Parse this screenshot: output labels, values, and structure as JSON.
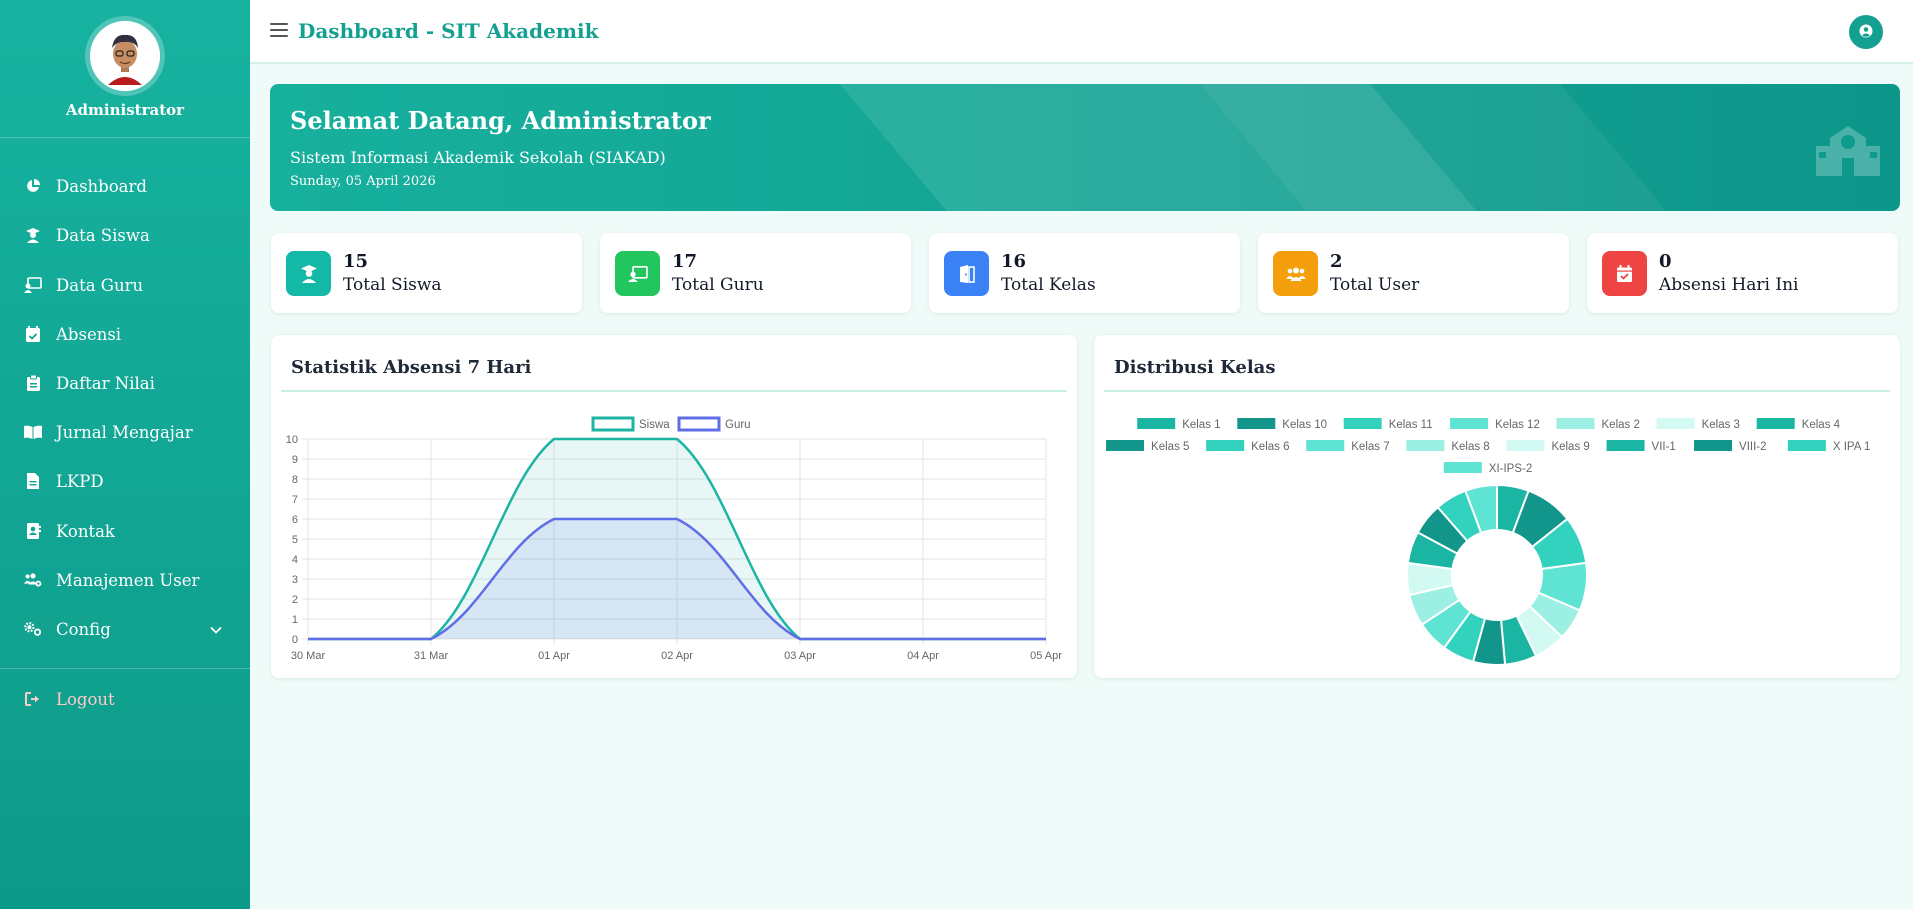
{
  "sidebar": {
    "user_name": "Administrator",
    "items": [
      {
        "label": "Dashboard",
        "icon": "chart-pie-icon"
      },
      {
        "label": "Data Siswa",
        "icon": "user-graduate-icon"
      },
      {
        "label": "Data Guru",
        "icon": "chalkboard-teacher-icon"
      },
      {
        "label": "Absensi",
        "icon": "calendar-check-icon"
      },
      {
        "label": "Daftar Nilai",
        "icon": "clipboard-icon"
      },
      {
        "label": "Jurnal Mengajar",
        "icon": "book-open-icon"
      },
      {
        "label": "LKPD",
        "icon": "file-icon"
      },
      {
        "label": "Kontak",
        "icon": "address-book-icon"
      },
      {
        "label": "Manajemen User",
        "icon": "users-cog-icon"
      },
      {
        "label": "Config",
        "icon": "gear-icon"
      }
    ],
    "logout": "Logout"
  },
  "topbar": {
    "title": "Dashboard - SIT Akademik"
  },
  "banner": {
    "title": "Selamat Datang, Administrator",
    "subtitle": "Sistem Informasi Akademik Sekolah (SIAKAD)",
    "date": "Sunday, 05 April 2026"
  },
  "stats": [
    {
      "value": "15",
      "label": "Total Siswa",
      "color": "#14b8a6",
      "icon": "user-graduate-icon"
    },
    {
      "value": "17",
      "label": "Total Guru",
      "color": "#22c55e",
      "icon": "chalkboard-teacher-icon"
    },
    {
      "value": "16",
      "label": "Total Kelas",
      "color": "#3b82f6",
      "icon": "door-open-icon"
    },
    {
      "value": "2",
      "label": "Total User",
      "color": "#f59e0b",
      "icon": "users-icon"
    },
    {
      "value": "0",
      "label": "Absensi Hari Ini",
      "color": "#ef4444",
      "icon": "calendar-check-icon"
    }
  ],
  "charts": {
    "line_title": "Statistik Absensi 7 Hari",
    "donut_title": "Distribusi Kelas"
  },
  "chart_data": [
    {
      "type": "line",
      "title": "Statistik Absensi 7 Hari",
      "categories": [
        "30 Mar",
        "31 Mar",
        "01 Apr",
        "02 Apr",
        "03 Apr",
        "04 Apr",
        "05 Apr"
      ],
      "series": [
        {
          "name": "Siswa",
          "values": [
            0,
            0,
            10,
            10,
            0,
            0,
            0
          ],
          "color": "#1cb5a3"
        },
        {
          "name": "Guru",
          "values": [
            0,
            0,
            6,
            6,
            0,
            0,
            0
          ],
          "color": "#5f6ee6"
        }
      ],
      "ylim": [
        0,
        10
      ],
      "yticks": [
        0,
        1,
        2,
        3,
        4,
        5,
        6,
        7,
        8,
        9,
        10
      ],
      "grid": true,
      "legend": "top"
    },
    {
      "type": "pie",
      "title": "Distribusi Kelas",
      "donut": true,
      "categories": [
        "Kelas 1",
        "Kelas 10",
        "Kelas 11",
        "Kelas 12",
        "Kelas 2",
        "Kelas 3",
        "Kelas 4",
        "Kelas 5",
        "Kelas 6",
        "Kelas 7",
        "Kelas 8",
        "Kelas 9",
        "VII-1",
        "VIII-2",
        "X IPA 1",
        "XI-IPS-2"
      ],
      "values": [
        2,
        3,
        3,
        3,
        2,
        2,
        2,
        2,
        2,
        2,
        2,
        2,
        2,
        2,
        2,
        2
      ],
      "colors": [
        "#1ab5a3",
        "#12958a",
        "#32d2bf",
        "#5fe3d3",
        "#9cf0e3",
        "#d2f9f2",
        "#1ab5a3",
        "#12958a",
        "#32d2bf",
        "#5fe3d3",
        "#9cf0e3",
        "#d2f9f2",
        "#1ab5a3",
        "#12958a",
        "#32d2bf",
        "#5fe3d3"
      ],
      "legend": "top"
    }
  ]
}
